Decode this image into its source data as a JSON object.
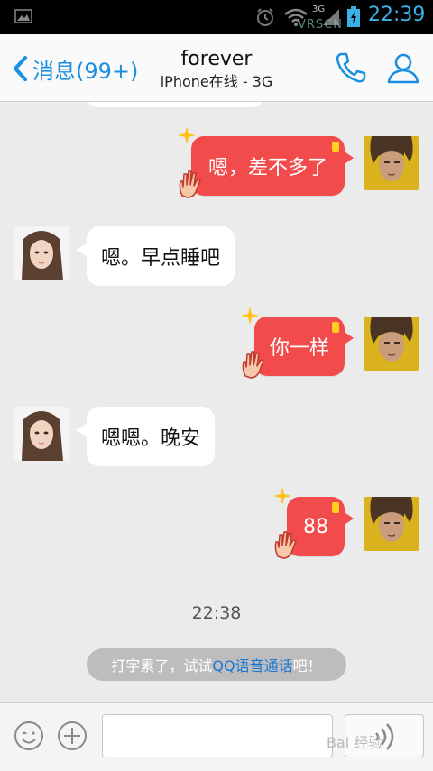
{
  "status_bar": {
    "network_label": "3G",
    "time": "22:39",
    "watermark": "VRSCN"
  },
  "header": {
    "back_label": "消息(99+)",
    "contact_name": "forever",
    "contact_status": "iPhone在线 - 3G"
  },
  "messages": [
    {
      "direction": "out",
      "text": "嗯，差不多了"
    },
    {
      "direction": "in",
      "text": "嗯。早点睡吧"
    },
    {
      "direction": "out",
      "text": "你一样"
    },
    {
      "direction": "in",
      "text": "嗯嗯。晚安"
    },
    {
      "direction": "out",
      "text": "88"
    }
  ],
  "timestamp": "22:38",
  "hint": {
    "prefix": "打字累了，试试",
    "link": "QQ语音通话",
    "suffix": "吧！"
  },
  "input": {
    "value": "",
    "watermark": "Bai 经验"
  },
  "colors": {
    "accent": "#1a8ee0",
    "outgoing_bubble": "#f24b4b",
    "incoming_bubble": "#ffffff",
    "background": "#ebebeb"
  }
}
